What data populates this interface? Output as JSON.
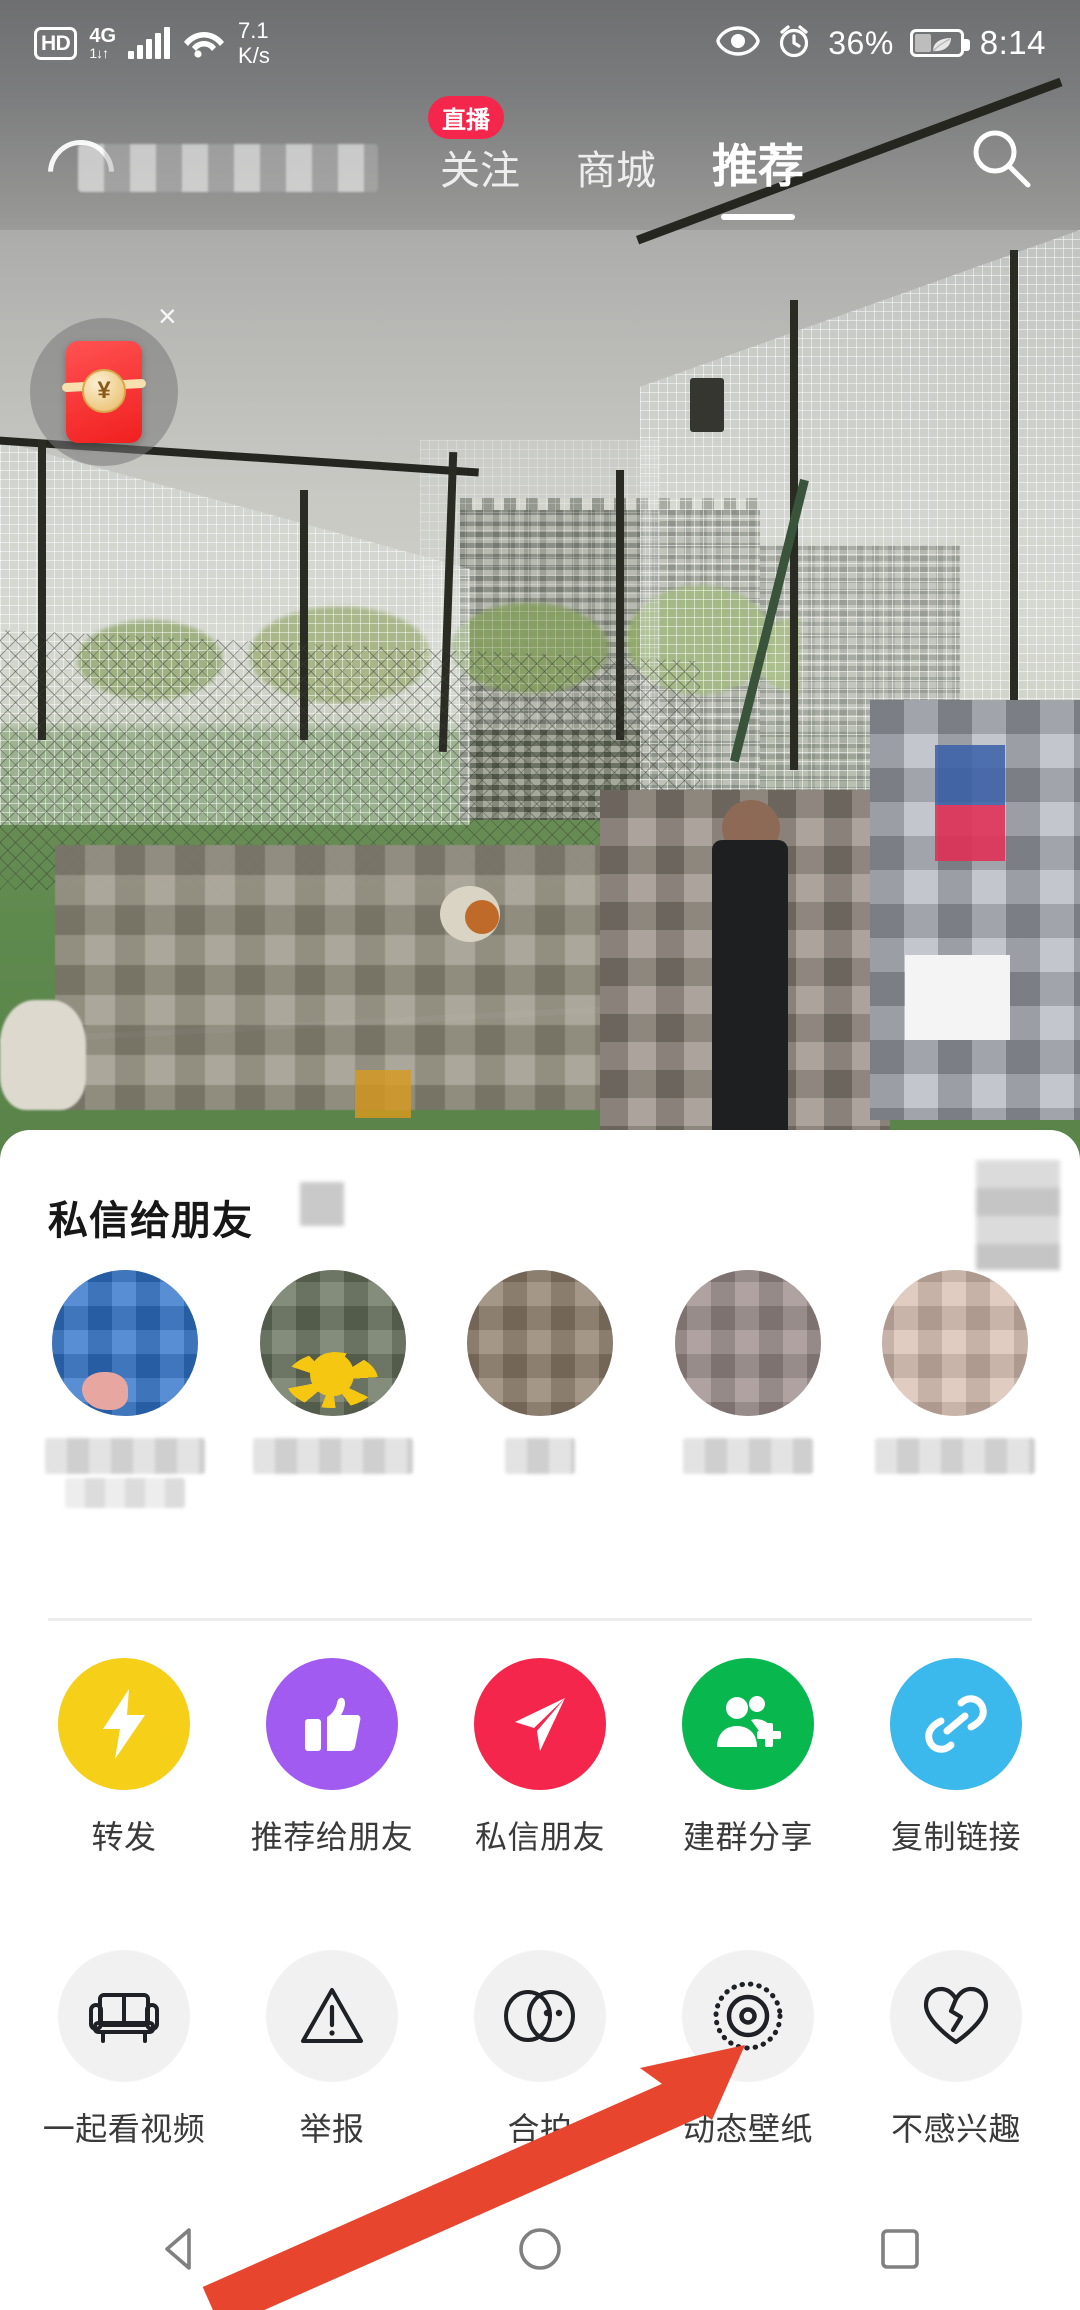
{
  "status_bar": {
    "hd_label": "HD",
    "network_type": "4G",
    "network_speed": "7.1",
    "network_speed_unit": "K/s",
    "eye_icon": "eye-comfort-icon",
    "alarm_icon": "alarm-clock-icon",
    "battery_percent": "36%",
    "battery_icon": "battery-power-saving-icon",
    "time": "8:14"
  },
  "top_nav": {
    "tabs": [
      {
        "label": "关注",
        "active": false,
        "badge": "直播"
      },
      {
        "label": "商城",
        "active": false,
        "badge": ""
      },
      {
        "label": "推荐",
        "active": true,
        "badge": ""
      }
    ],
    "search_icon": "search-icon"
  },
  "floating": {
    "red_packet_icon": "red-envelope-icon",
    "red_packet_currency": "¥",
    "close_label": "×"
  },
  "share_sheet": {
    "title": "私信给朋友",
    "friends": [
      {
        "name": "",
        "avatar": "friend-avatar-1"
      },
      {
        "name": "",
        "avatar": "friend-avatar-2"
      },
      {
        "name": "",
        "avatar": "friend-avatar-3"
      },
      {
        "name": "",
        "avatar": "friend-avatar-4"
      },
      {
        "name": "",
        "avatar": "friend-avatar-5"
      }
    ],
    "actions_row_1": [
      {
        "label": "转发",
        "icon": "lightning-bolt-icon",
        "color": "#F6CF18"
      },
      {
        "label": "推荐给朋友",
        "icon": "thumbs-up-icon",
        "color": "#A15BF0"
      },
      {
        "label": "私信朋友",
        "icon": "paper-plane-icon",
        "color": "#F5264C"
      },
      {
        "label": "建群分享",
        "icon": "add-group-icon",
        "color": "#09B74F"
      },
      {
        "label": "复制链接",
        "icon": "link-chain-icon",
        "color": "#3BB8EC"
      }
    ],
    "actions_row_2": [
      {
        "label": "一起看视频",
        "icon": "sofa-icon",
        "color": "#F1F1F1"
      },
      {
        "label": "举报",
        "icon": "warning-triangle-icon",
        "color": "#F1F1F1"
      },
      {
        "label": "合拍",
        "icon": "duet-circles-icon",
        "color": "#F1F1F1"
      },
      {
        "label": "动态壁纸",
        "icon": "live-wallpaper-icon",
        "color": "#F1F1F1"
      },
      {
        "label": "不感兴趣",
        "icon": "broken-heart-icon",
        "color": "#F1F1F1"
      }
    ]
  },
  "annotation": {
    "arrow_color": "#E8452F",
    "points_at": "动态壁纸"
  },
  "android_nav": {
    "back_icon": "back-triangle-icon",
    "home_icon": "home-circle-icon",
    "recents_icon": "recents-square-icon"
  }
}
